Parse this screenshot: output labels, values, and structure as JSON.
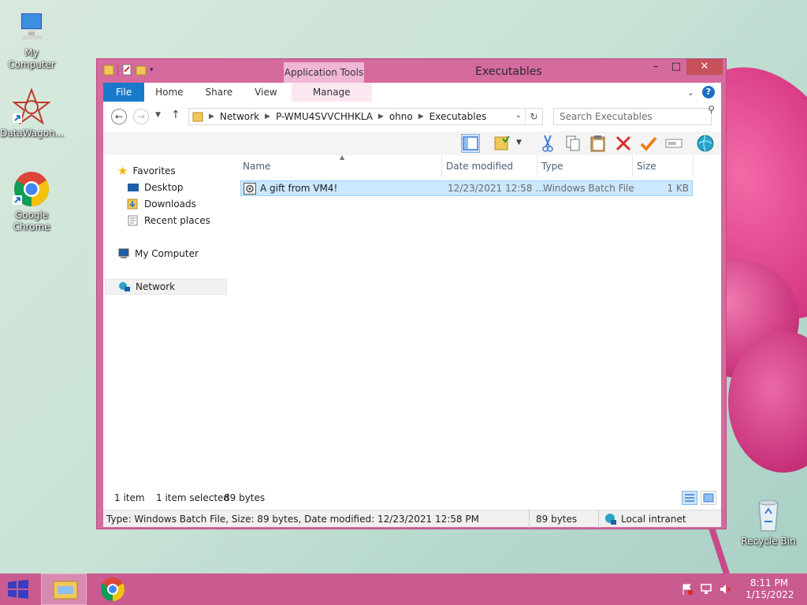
{
  "desktop": {
    "icons": [
      {
        "label": "My Computer",
        "icon": "computer-icon"
      },
      {
        "label": "DataWagon...",
        "icon": "datawagon-icon"
      },
      {
        "label": "Google Chrome",
        "icon": "chrome-icon"
      },
      {
        "label": "Recycle Bin",
        "icon": "recycle-bin-icon"
      }
    ]
  },
  "window": {
    "title": "Executables",
    "context_tab_header": "Application Tools",
    "controls": {
      "minimize": "–",
      "maximize": "□",
      "close": "✕"
    },
    "ribbon_tabs": [
      "File",
      "Home",
      "Share",
      "View",
      "Manage"
    ],
    "help": "?",
    "address": {
      "crumbs": [
        "Network",
        "P-WMU4SVVCHHKLA",
        "ohno",
        "Executables"
      ]
    },
    "search_placeholder": "Search Executables",
    "nav_pane": {
      "favorites": "Favorites",
      "favorites_items": [
        "Desktop",
        "Downloads",
        "Recent places"
      ],
      "my_computer": "My Computer",
      "network": "Network"
    },
    "columns": [
      "Name",
      "Date modified",
      "Type",
      "Size"
    ],
    "files": [
      {
        "name": "A gift from VM4!",
        "date_modified": "12/23/2021 12:58 ...",
        "type": "Windows Batch File",
        "size": "1 KB"
      }
    ],
    "status": {
      "item_count": "1 item",
      "selection": "1 item selected",
      "selection_size": "89 bytes",
      "details": "Type: Windows Batch File, Size: 89 bytes, Date modified: 12/23/2021 12:58 PM",
      "size": "89 bytes",
      "zone": "Local intranet"
    }
  },
  "taskbar": {
    "time": "8:11 PM",
    "date": "1/15/2022"
  },
  "colors": {
    "window_frame": "#d46a9e",
    "taskbar": "#c95b90",
    "file_tab": "#1979ca",
    "selection": "#cce8ff"
  }
}
